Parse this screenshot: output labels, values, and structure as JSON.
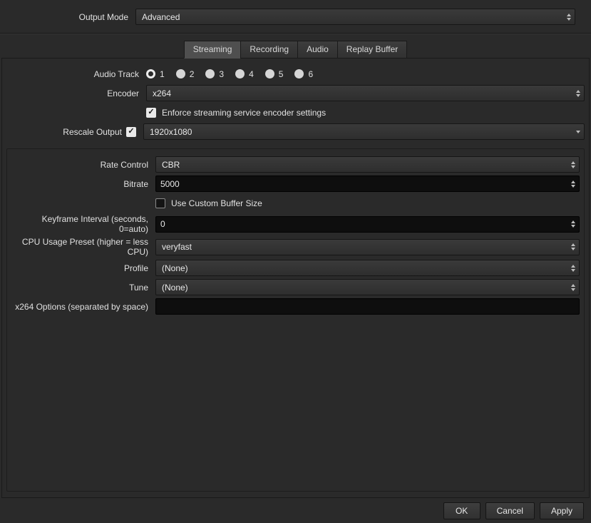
{
  "icons": {
    "check": "✓"
  },
  "output_mode": {
    "label": "Output Mode",
    "value": "Advanced"
  },
  "tabs": [
    {
      "label": "Streaming",
      "active": true
    },
    {
      "label": "Recording",
      "active": false
    },
    {
      "label": "Audio",
      "active": false
    },
    {
      "label": "Replay Buffer",
      "active": false
    }
  ],
  "streaming": {
    "audio_track": {
      "label": "Audio Track",
      "options": [
        "1",
        "2",
        "3",
        "4",
        "5",
        "6"
      ],
      "selected": "1"
    },
    "encoder": {
      "label": "Encoder",
      "value": "x264"
    },
    "enforce": {
      "label": "Enforce streaming service encoder settings",
      "checked": true
    },
    "rescale": {
      "label": "Rescale Output",
      "checked": true,
      "value": "1920x1080"
    },
    "advanced": {
      "rate_control": {
        "label": "Rate Control",
        "value": "CBR"
      },
      "bitrate": {
        "label": "Bitrate",
        "value": "5000"
      },
      "custom_buffer": {
        "label": "Use Custom Buffer Size",
        "checked": false
      },
      "keyframe_interval": {
        "label": "Keyframe Interval (seconds, 0=auto)",
        "value": "0"
      },
      "cpu_preset": {
        "label": "CPU Usage Preset (higher = less CPU)",
        "value": "veryfast"
      },
      "profile": {
        "label": "Profile",
        "value": "(None)"
      },
      "tune": {
        "label": "Tune",
        "value": "(None)"
      },
      "x264_options": {
        "label": "x264 Options (separated by space)",
        "value": ""
      }
    }
  },
  "footer": {
    "ok": "OK",
    "cancel": "Cancel",
    "apply": "Apply"
  }
}
